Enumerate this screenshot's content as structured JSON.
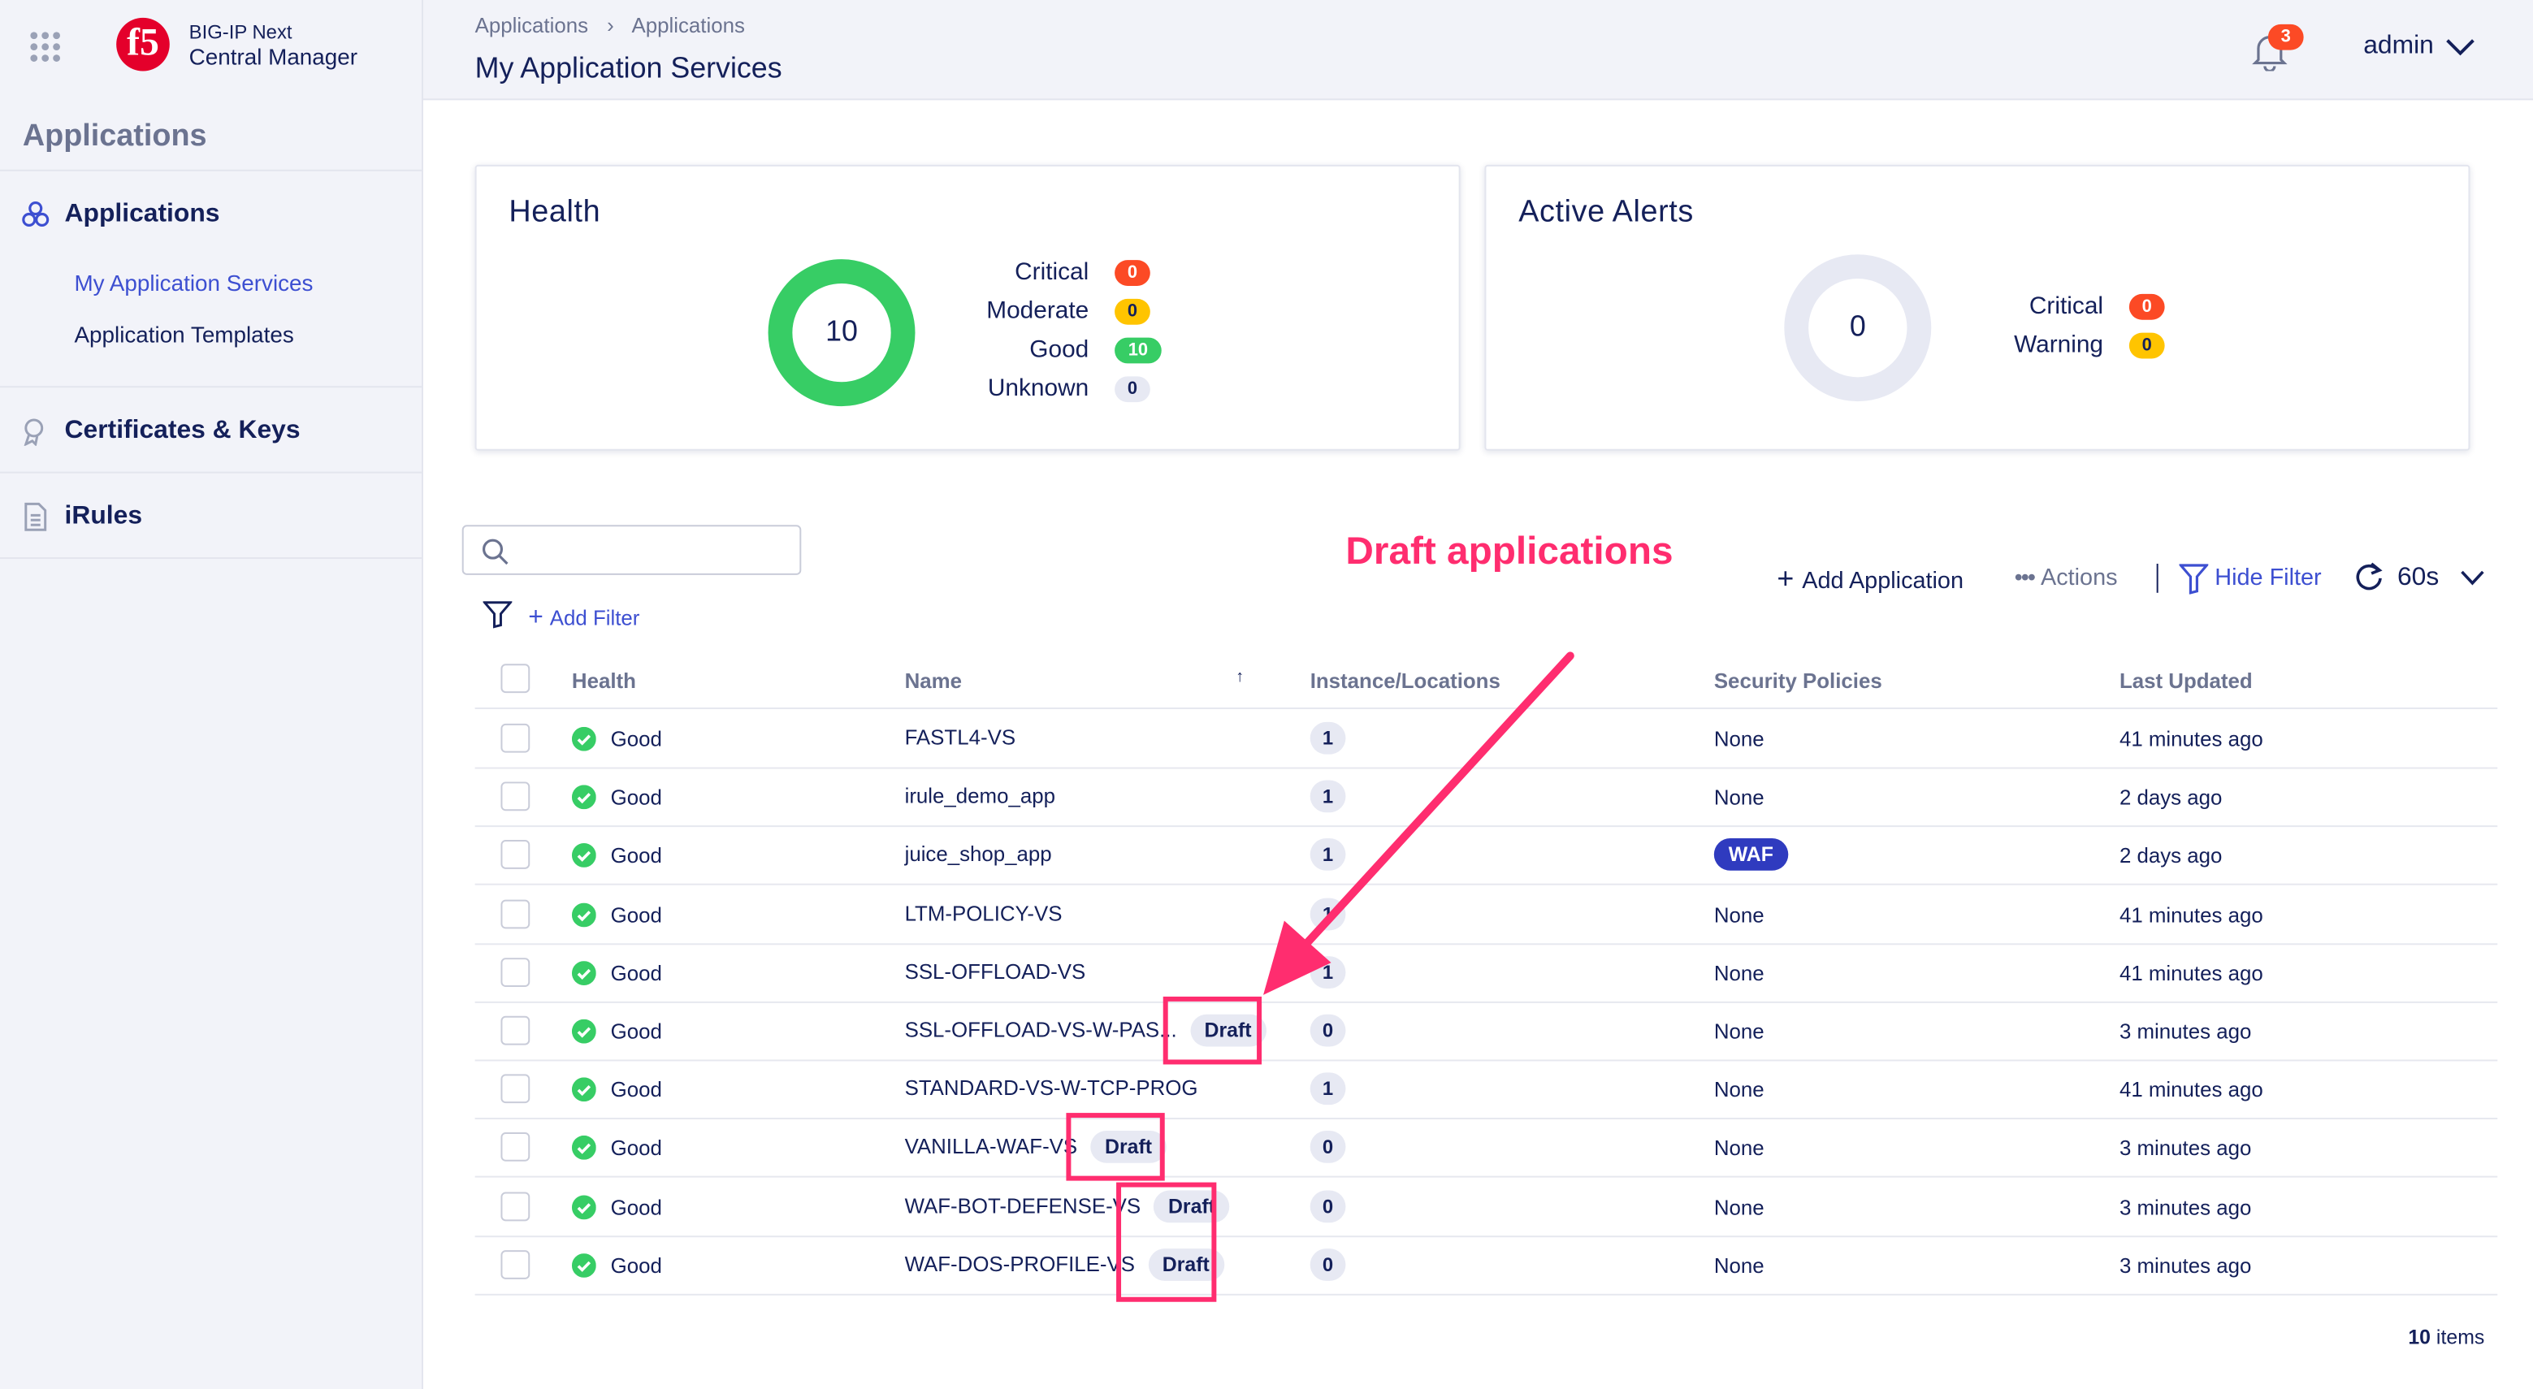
{
  "app": {
    "brand_line1": "BIG-IP Next",
    "brand_line2": "Central Manager",
    "logo_text": "f5"
  },
  "sidebar": {
    "section_title": "Applications",
    "groups": [
      {
        "label": "Applications",
        "icon": "applications-icon",
        "items": [
          {
            "label": "My Application Services",
            "active": true
          },
          {
            "label": "Application Templates"
          }
        ]
      },
      {
        "label": "Certificates & Keys",
        "icon": "certificate-icon"
      },
      {
        "label": "iRules",
        "icon": "document-icon"
      }
    ]
  },
  "header": {
    "breadcrumb": [
      "Applications",
      "Applications"
    ],
    "title": "My Application Services",
    "notifications": "3",
    "user": "admin"
  },
  "health": {
    "title": "Health",
    "total": "10",
    "legend": [
      {
        "label": "Critical",
        "value": "0",
        "color": "#fc4a25"
      },
      {
        "label": "Moderate",
        "value": "0",
        "color": "#ffc400"
      },
      {
        "label": "Good",
        "value": "10",
        "color": "#37cd65"
      },
      {
        "label": "Unknown",
        "value": "0",
        "color": "#e7e9f3"
      }
    ]
  },
  "alerts": {
    "title": "Active Alerts",
    "total": "0",
    "legend": [
      {
        "label": "Critical",
        "value": "0",
        "color": "#fc4a25"
      },
      {
        "label": "Warning",
        "value": "0",
        "color": "#ffc400"
      }
    ]
  },
  "toolbar": {
    "search_placeholder": "",
    "add_filter": "Add Filter",
    "add_application": "Add Application",
    "actions": "Actions",
    "hide_filter": "Hide Filter",
    "refresh_interval": "60s"
  },
  "table": {
    "columns": [
      "Health",
      "Name",
      "Instance/Locations",
      "Security Policies",
      "Last Updated"
    ],
    "rows": [
      {
        "health": "Good",
        "name": "FASTL4-VS",
        "draft": "",
        "instances": "1",
        "policies": "None",
        "updated": "41 minutes ago"
      },
      {
        "health": "Good",
        "name": "irule_demo_app",
        "draft": "",
        "instances": "1",
        "policies": "None",
        "updated": "2 days ago"
      },
      {
        "health": "Good",
        "name": "juice_shop_app",
        "draft": "",
        "instances": "1",
        "policies": "WAF",
        "updated": "2 days ago"
      },
      {
        "health": "Good",
        "name": "LTM-POLICY-VS",
        "draft": "",
        "instances": "1",
        "policies": "None",
        "updated": "41 minutes ago"
      },
      {
        "health": "Good",
        "name": "SSL-OFFLOAD-VS",
        "draft": "",
        "instances": "1",
        "policies": "None",
        "updated": "41 minutes ago"
      },
      {
        "health": "Good",
        "name": "SSL-OFFLOAD-VS-W-PAS...",
        "draft": "Draft",
        "instances": "0",
        "policies": "None",
        "updated": "3 minutes ago"
      },
      {
        "health": "Good",
        "name": "STANDARD-VS-W-TCP-PROG",
        "draft": "",
        "instances": "1",
        "policies": "None",
        "updated": "41 minutes ago"
      },
      {
        "health": "Good",
        "name": "VANILLA-WAF-VS",
        "draft": "Draft",
        "instances": "0",
        "policies": "None",
        "updated": "3 minutes ago"
      },
      {
        "health": "Good",
        "name": "WAF-BOT-DEFENSE-VS",
        "draft": "Draft",
        "instances": "0",
        "policies": "None",
        "updated": "3 minutes ago"
      },
      {
        "health": "Good",
        "name": "WAF-DOS-PROFILE-VS",
        "draft": "Draft",
        "instances": "0",
        "policies": "None",
        "updated": "3 minutes ago"
      }
    ],
    "footer": {
      "count": "10",
      "suffix": "items"
    }
  },
  "annotation": {
    "text": "Draft applications",
    "color": "#ff2d6f"
  }
}
